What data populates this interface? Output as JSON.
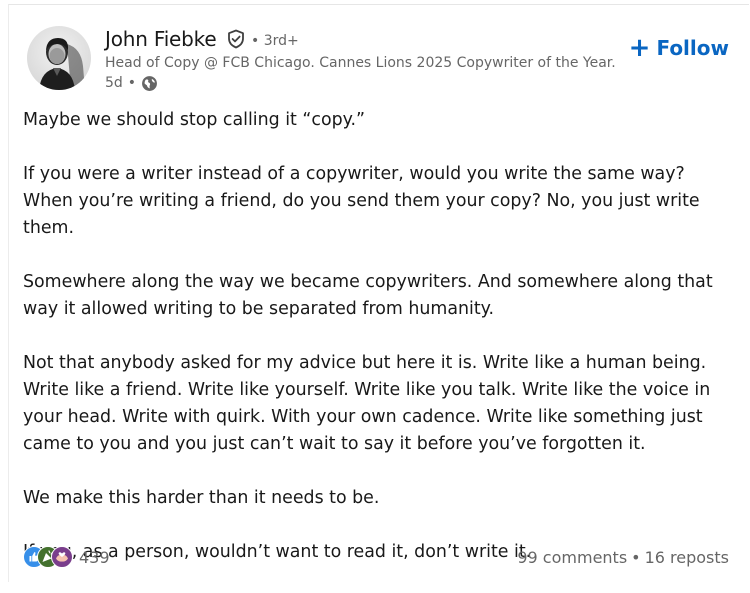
{
  "author": {
    "name": "John Fiebke",
    "degree": "• 3rd+",
    "headline": "Head of Copy @ FCB Chicago. Cannes Lions 2025 Copywriter of the Year.",
    "time": "5d",
    "meta_separator": "•",
    "visibility_icon": "globe-icon",
    "verified_icon": "verified-shield-icon"
  },
  "follow": {
    "plus": "+",
    "label": "Follow"
  },
  "post": {
    "paragraphs": [
      "Maybe we should stop calling it “copy.”",
      "If you were a writer instead of a copywriter, would you write the same way? When you’re writing a friend, do you send them your copy? No, you just write them.",
      "Somewhere along the way we became copywriters. And somewhere along that way it allowed writing to be separated from humanity.",
      "Not that anybody asked for my advice but here it is. Write like a human being. Write like a friend. Write like yourself. Write like you talk. Write like the voice in your head. Write with quirk. With your own cadence. Write like something just came to you and you just can’t wait to say it before you’ve forgotten it.",
      "We make this harder than it needs to be.",
      "If you, as a person, wouldn’t want to read it, don’t write it."
    ]
  },
  "social": {
    "reaction_count": "439",
    "comments": "99 comments",
    "separator": "•",
    "reposts": "16 reposts",
    "reaction_icons": [
      "like-icon",
      "celebrate-icon",
      "support-icon"
    ]
  },
  "colors": {
    "accent": "#0a66c2",
    "text_primary": "#191919",
    "text_secondary": "#666666"
  }
}
